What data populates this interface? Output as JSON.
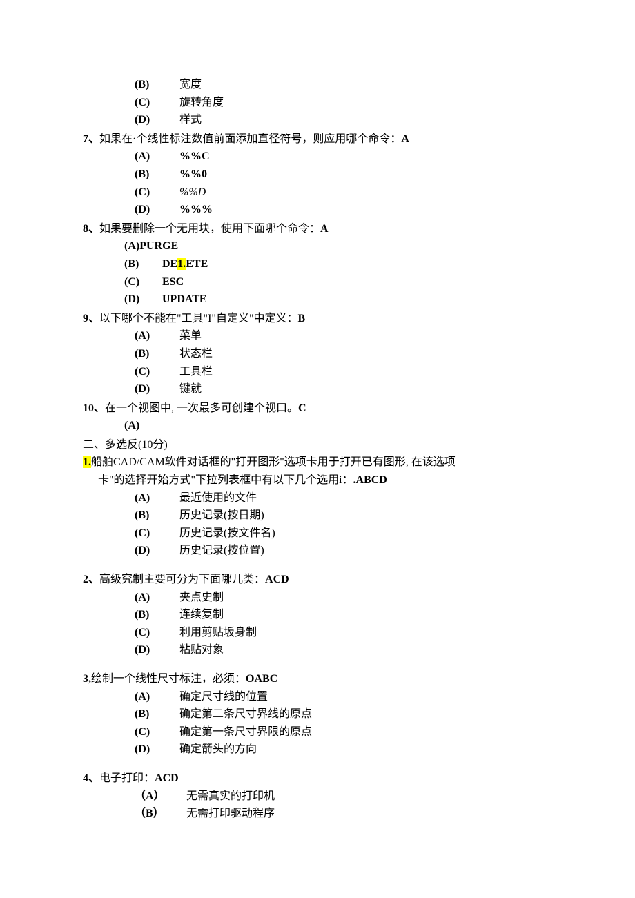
{
  "q6_continued": {
    "options": [
      {
        "letter": "(B)",
        "text": "宽度"
      },
      {
        "letter": "(C)",
        "text": "旋转角度"
      },
      {
        "letter": "(D)",
        "text": "样式"
      }
    ]
  },
  "q7": {
    "prefix": "7、",
    "text": "如果在·个线性标注数值前面添加直径符号，则应用哪个命令：",
    "answer": "A",
    "options": [
      {
        "letter": "(A)",
        "text": "%%C",
        "bold": true
      },
      {
        "letter": "(B)",
        "text": "%%0",
        "bold": true
      },
      {
        "letter": "(C)",
        "text": "%%D",
        "italic": true
      },
      {
        "letter": "(D)",
        "text": "%%%",
        "bold": true
      }
    ]
  },
  "q8": {
    "prefix": "8、",
    "text": "如果要删除一个无用块，使用下面哪个命令：",
    "answer": "A",
    "option_a": "(A)PURGE",
    "option_b_letter": "(B)",
    "option_b_pre": "DE",
    "option_b_hl": "1.",
    "option_b_post": "ETE",
    "option_c_letter": "(C)",
    "option_c_text": "ESC",
    "option_d_letter": "(D)",
    "option_d_text": "UPDATE"
  },
  "q9": {
    "prefix": "9、",
    "text": "以下哪个不能在\"工具\"I\"自定义\"中定义：",
    "answer": "B",
    "options": [
      {
        "letter": "(A)",
        "text": "菜单"
      },
      {
        "letter": "(B)",
        "text": "状态栏"
      },
      {
        "letter": "(C)",
        "text": "工具栏"
      },
      {
        "letter": "(D)",
        "text": "键就"
      }
    ]
  },
  "q10": {
    "prefix": "10、",
    "text": "在一个视图中, 一次最多可创建个视口。",
    "answer": "C",
    "option_letter": "(A)"
  },
  "section2": {
    "title": "二、多选反(10分)"
  },
  "s2q1": {
    "prefix_hl": "1.",
    "line1": "船舶CAD/CAM软件对话框的\"打开图形\"选项卡用于打开已有图形, 在该选项",
    "line2": "卡\"的选择开始方式\"下拉列表框中有以下几个选用i：",
    "answer": ".ABCD",
    "options": [
      {
        "letter": "(A)",
        "text": "最近使用的文件"
      },
      {
        "letter": "(B)",
        "text": "历史记录(按日期)"
      },
      {
        "letter": "(C)",
        "text": "历史记录(按文件名)"
      },
      {
        "letter": "(D)",
        "text": "历史记录(按位置)"
      }
    ]
  },
  "s2q2": {
    "prefix": "2、",
    "text": "高级究制主要可分为下面哪儿类：",
    "answer": "ACD",
    "options": [
      {
        "letter": "(A)",
        "text": "夹点史制"
      },
      {
        "letter": "(B)",
        "text": "连续复制"
      },
      {
        "letter": "(C)",
        "text": "利用剪贴坂身制"
      },
      {
        "letter": "(D)",
        "text": "粘贴对象"
      }
    ]
  },
  "s2q3": {
    "prefix": "3,",
    "text": "绘制一个线性尺寸标注，必须：",
    "answer": "OABC",
    "options": [
      {
        "letter": "(A)",
        "text": "确定尺寸线的位置"
      },
      {
        "letter": "(B)",
        "text": "确定第二条尺寸界线的原点"
      },
      {
        "letter": "(C)",
        "text": "确定第一条尺寸界限的原点"
      },
      {
        "letter": "(D)",
        "text": "确定箭头的方向"
      }
    ]
  },
  "s2q4": {
    "prefix": "4、",
    "text": "电子打印：",
    "answer": "ACD",
    "options": [
      {
        "letter": "（A）",
        "text": "无需真实的打印机"
      },
      {
        "letter": "（B）",
        "text": "无需打印驱动程序"
      }
    ]
  }
}
